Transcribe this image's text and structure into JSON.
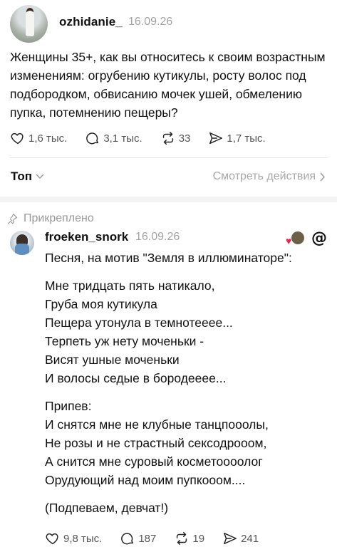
{
  "post": {
    "username": "ozhidanie_",
    "date": "16.09.26",
    "text": "Женщины 35+, как вы относитесь к своим возрастным изменениям: огрубению кутикулы, росту волос под подбородком, обвисанию мочек ушей, обмелению пупка, потемнению пещеры?",
    "likes": "1,6 тыс.",
    "comments": "3,1 тыс.",
    "reposts": "33",
    "shares": "1,7 тыс."
  },
  "sort": {
    "label": "Топ",
    "view_actions": "Смотреть действия"
  },
  "reply": {
    "pinned_label": "Прикреплено",
    "username": "froeken_snork",
    "date": "16.09.26",
    "lines": [
      "Песня, на мотив \"Земля в иллюминаторе\":",
      "",
      "Мне тридцать пять натикало,",
      "Груба моя кутикула",
      "Пещера утонула в темнотееее...",
      "Терпеть уж нету моченьки -",
      "Висят ушные моченьки",
      "И волосы седые в бородееее...",
      "",
      "Припев:",
      "И снятся мне не клубные танцпооолы,",
      "Не розы и не страстный сексодрооом,",
      "А снится мне суровый косметоооолог",
      "Орудующий над моим пупкооом....",
      "",
      "(Подпеваем, девчат!)"
    ],
    "likes": "9,8 тыс.",
    "comments": "187",
    "reposts": "19",
    "shares": "241"
  },
  "icons": {
    "like": "heart-icon",
    "comment": "comment-icon",
    "repost": "repost-icon",
    "share": "share-icon",
    "pin": "pin-icon",
    "threads": "threads-icon"
  },
  "colors": {
    "muted": "#a3a3a3",
    "heart": "#e6234f"
  }
}
